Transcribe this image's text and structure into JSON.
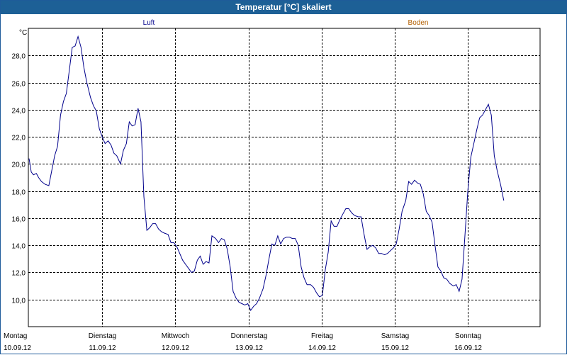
{
  "window": {
    "title": "Temperatur [°C] skaliert"
  },
  "colors": {
    "titlebar": "#1d6096",
    "luft": "#00008b",
    "boden": "#b25f00",
    "grid": "#000000"
  },
  "chart_data": {
    "type": "line",
    "title": "Temperatur [°C] skaliert",
    "ylabel": "°C",
    "xlabel": "",
    "ylim": [
      8.0,
      30.0
    ],
    "xlim": [
      0,
      7
    ],
    "yticks": [
      10.0,
      12.0,
      14.0,
      16.0,
      18.0,
      20.0,
      22.0,
      24.0,
      26.0,
      28.0
    ],
    "ytick_labels": [
      "10,0",
      "12,0",
      "14,0",
      "16,0",
      "18,0",
      "20,0",
      "22,0",
      "24,0",
      "26,0",
      "28,0"
    ],
    "grid": true,
    "legend_placement": "top",
    "x_ticks": [
      {
        "day": "Montag",
        "date": "10.09.12"
      },
      {
        "day": "Dienstag",
        "date": "11.09.12"
      },
      {
        "day": "Mittwoch",
        "date": "12.09.12"
      },
      {
        "day": "Donnerstag",
        "date": "13.09.12"
      },
      {
        "day": "Freitag",
        "date": "14.09.12"
      },
      {
        "day": "Samstag",
        "date": "15.09.12"
      },
      {
        "day": "Sonntag",
        "date": "16.09.12"
      }
    ],
    "series": [
      {
        "name": "Luft",
        "color": "#00008b",
        "points": [
          [
            0.0,
            20.4
          ],
          [
            0.03,
            19.4
          ],
          [
            0.06,
            19.2
          ],
          [
            0.1,
            19.3
          ],
          [
            0.13,
            19.0
          ],
          [
            0.17,
            18.7
          ],
          [
            0.22,
            18.5
          ],
          [
            0.27,
            18.4
          ],
          [
            0.31,
            19.5
          ],
          [
            0.35,
            20.6
          ],
          [
            0.39,
            21.3
          ],
          [
            0.43,
            23.6
          ],
          [
            0.47,
            24.6
          ],
          [
            0.51,
            25.2
          ],
          [
            0.55,
            26.9
          ],
          [
            0.59,
            28.6
          ],
          [
            0.63,
            28.7
          ],
          [
            0.67,
            29.4
          ],
          [
            0.71,
            28.6
          ],
          [
            0.75,
            27.1
          ],
          [
            0.79,
            26.0
          ],
          [
            0.84,
            24.9
          ],
          [
            0.88,
            24.3
          ],
          [
            0.92,
            23.9
          ],
          [
            0.96,
            22.6
          ],
          [
            1.0,
            22.0
          ],
          [
            1.04,
            21.5
          ],
          [
            1.08,
            21.7
          ],
          [
            1.12,
            21.4
          ],
          [
            1.16,
            20.8
          ],
          [
            1.2,
            20.6
          ],
          [
            1.25,
            20.0
          ],
          [
            1.29,
            21.0
          ],
          [
            1.33,
            21.5
          ],
          [
            1.37,
            23.1
          ],
          [
            1.41,
            22.8
          ],
          [
            1.45,
            22.9
          ],
          [
            1.49,
            24.1
          ],
          [
            1.53,
            23.1
          ],
          [
            1.57,
            17.6
          ],
          [
            1.61,
            15.1
          ],
          [
            1.65,
            15.3
          ],
          [
            1.69,
            15.6
          ],
          [
            1.73,
            15.6
          ],
          [
            1.77,
            15.2
          ],
          [
            1.81,
            15.0
          ],
          [
            1.85,
            14.9
          ],
          [
            1.9,
            14.8
          ],
          [
            1.94,
            14.2
          ],
          [
            1.98,
            14.2
          ],
          [
            2.02,
            13.9
          ],
          [
            2.06,
            13.4
          ],
          [
            2.1,
            12.9
          ],
          [
            2.14,
            12.6
          ],
          [
            2.18,
            12.3
          ],
          [
            2.22,
            12.0
          ],
          [
            2.26,
            12.1
          ],
          [
            2.3,
            12.9
          ],
          [
            2.34,
            13.2
          ],
          [
            2.38,
            12.6
          ],
          [
            2.42,
            12.8
          ],
          [
            2.46,
            12.7
          ],
          [
            2.5,
            14.7
          ],
          [
            2.55,
            14.5
          ],
          [
            2.59,
            14.2
          ],
          [
            2.63,
            14.5
          ],
          [
            2.67,
            14.4
          ],
          [
            2.71,
            13.7
          ],
          [
            2.75,
            12.4
          ],
          [
            2.79,
            10.6
          ],
          [
            2.83,
            10.1
          ],
          [
            2.87,
            9.8
          ],
          [
            2.91,
            9.7
          ],
          [
            2.95,
            9.6
          ],
          [
            2.99,
            9.7
          ],
          [
            3.03,
            9.2
          ],
          [
            3.07,
            9.5
          ],
          [
            3.11,
            9.7
          ],
          [
            3.15,
            10.1
          ],
          [
            3.2,
            10.8
          ],
          [
            3.24,
            11.8
          ],
          [
            3.28,
            13.0
          ],
          [
            3.32,
            14.1
          ],
          [
            3.36,
            14.0
          ],
          [
            3.4,
            14.7
          ],
          [
            3.44,
            14.1
          ],
          [
            3.48,
            14.5
          ],
          [
            3.52,
            14.6
          ],
          [
            3.56,
            14.6
          ],
          [
            3.6,
            14.5
          ],
          [
            3.64,
            14.5
          ],
          [
            3.68,
            14.0
          ],
          [
            3.72,
            12.4
          ],
          [
            3.76,
            11.6
          ],
          [
            3.8,
            11.1
          ],
          [
            3.85,
            11.1
          ],
          [
            3.89,
            10.9
          ],
          [
            3.93,
            10.5
          ],
          [
            3.97,
            10.2
          ],
          [
            4.01,
            10.3
          ],
          [
            4.05,
            12.2
          ],
          [
            4.09,
            13.5
          ],
          [
            4.13,
            15.8
          ],
          [
            4.17,
            15.4
          ],
          [
            4.21,
            15.4
          ],
          [
            4.25,
            15.9
          ],
          [
            4.29,
            16.3
          ],
          [
            4.33,
            16.7
          ],
          [
            4.37,
            16.7
          ],
          [
            4.41,
            16.4
          ],
          [
            4.45,
            16.2
          ],
          [
            4.5,
            16.1
          ],
          [
            4.54,
            16.1
          ],
          [
            4.58,
            14.8
          ],
          [
            4.62,
            13.7
          ],
          [
            4.66,
            13.9
          ],
          [
            4.7,
            14.0
          ],
          [
            4.74,
            13.8
          ],
          [
            4.78,
            13.4
          ],
          [
            4.82,
            13.4
          ],
          [
            4.86,
            13.3
          ],
          [
            4.9,
            13.4
          ],
          [
            4.94,
            13.6
          ],
          [
            4.98,
            13.8
          ],
          [
            5.02,
            14.1
          ],
          [
            5.06,
            15.2
          ],
          [
            5.1,
            16.5
          ],
          [
            5.15,
            17.3
          ],
          [
            5.19,
            18.7
          ],
          [
            5.23,
            18.5
          ],
          [
            5.27,
            18.8
          ],
          [
            5.31,
            18.6
          ],
          [
            5.35,
            18.5
          ],
          [
            5.39,
            17.8
          ],
          [
            5.43,
            16.5
          ],
          [
            5.47,
            16.2
          ],
          [
            5.51,
            15.7
          ],
          [
            5.55,
            14.0
          ],
          [
            5.59,
            12.4
          ],
          [
            5.63,
            12.1
          ],
          [
            5.67,
            11.6
          ],
          [
            5.71,
            11.5
          ],
          [
            5.75,
            11.2
          ],
          [
            5.8,
            11.0
          ],
          [
            5.84,
            11.1
          ],
          [
            5.88,
            10.6
          ],
          [
            5.92,
            11.5
          ],
          [
            5.96,
            14.8
          ],
          [
            6.0,
            18.1
          ],
          [
            6.04,
            20.5
          ],
          [
            6.08,
            21.5
          ],
          [
            6.12,
            22.5
          ],
          [
            6.16,
            23.4
          ],
          [
            6.2,
            23.6
          ],
          [
            6.24,
            24.0
          ],
          [
            6.28,
            24.4
          ],
          [
            6.32,
            23.6
          ],
          [
            6.36,
            20.6
          ],
          [
            6.4,
            19.5
          ],
          [
            6.45,
            18.4
          ],
          [
            6.49,
            17.3
          ]
        ]
      }
    ],
    "legend": [
      {
        "label": "Luft",
        "color": "#00008b"
      },
      {
        "label": "Boden",
        "color": "#b25f00"
      }
    ]
  }
}
